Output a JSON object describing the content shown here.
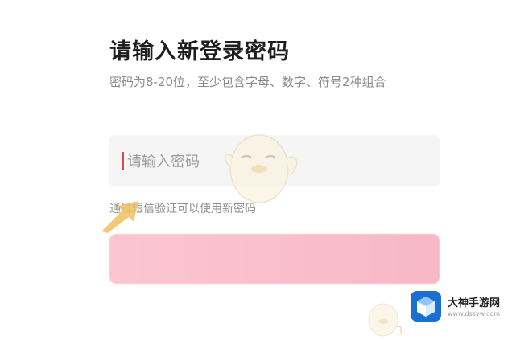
{
  "page": {
    "title": "请输入新登录密码",
    "subtitle": "密码为8-20位，至少包含字母、数字、符号2种组合"
  },
  "password_field": {
    "placeholder": "请输入密码",
    "value": ""
  },
  "hint": "通过短信验证可以使用新密码",
  "submit_button": {
    "label": "",
    "color": "#f8bfcb"
  },
  "watermark": {
    "brand": "大神手游网",
    "url": "www.dssyw.com",
    "small_text": "3"
  },
  "colors": {
    "accent": "#f8bfcb",
    "caret": "#e0464f",
    "logo_blue": "#1a6fd4"
  }
}
